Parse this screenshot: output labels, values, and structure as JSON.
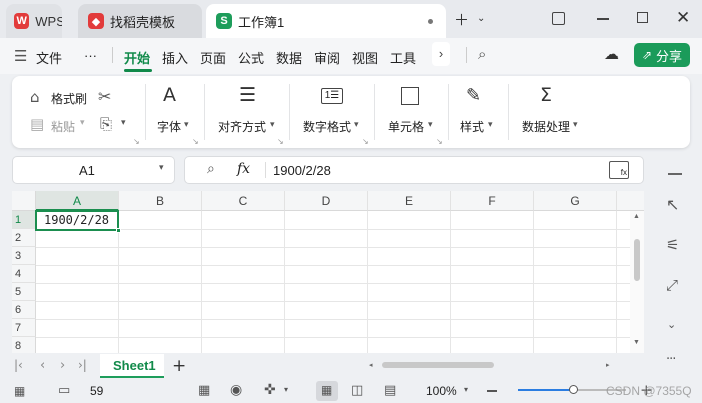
{
  "tabs": [
    {
      "label": "WPS"
    },
    {
      "label": "找稻壳模板"
    },
    {
      "label": "工作簿1"
    }
  ],
  "tab_icons": {
    "wps": "W",
    "template": "◆",
    "book": "S"
  },
  "colors": {
    "accent": "#118a4a",
    "share": "#1b9b5a",
    "wps_red": "#e23b3b",
    "sheet_green": "#1e9d5b",
    "selection": "#1b8e4f"
  },
  "menu": {
    "file": "文件",
    "more": "···",
    "items": [
      "开始",
      "插入",
      "页面",
      "公式",
      "数据",
      "审阅",
      "视图",
      "工具"
    ],
    "share": "分享"
  },
  "ribbon": {
    "format_painter": "格式刷",
    "paste": "粘贴",
    "font": "字体",
    "align": "对齐方式",
    "number_format": "数字格式",
    "cell": "单元格",
    "style": "样式",
    "data_process": "数据处理"
  },
  "formula_bar": {
    "cell_ref": "A1",
    "fx": "fx",
    "value": "1900/2/28"
  },
  "columns": [
    "A",
    "B",
    "C",
    "D",
    "E",
    "F",
    "G"
  ],
  "rows": [
    "1",
    "2",
    "3",
    "4",
    "5",
    "6",
    "7",
    "8"
  ],
  "cells": {
    "A1": "1900/2/28"
  },
  "sheets": [
    {
      "name": "Sheet1"
    }
  ],
  "add_sheet": "+",
  "status": {
    "page_count": "59",
    "zoom": "100%",
    "watermark": "CSDN @7355Q"
  }
}
